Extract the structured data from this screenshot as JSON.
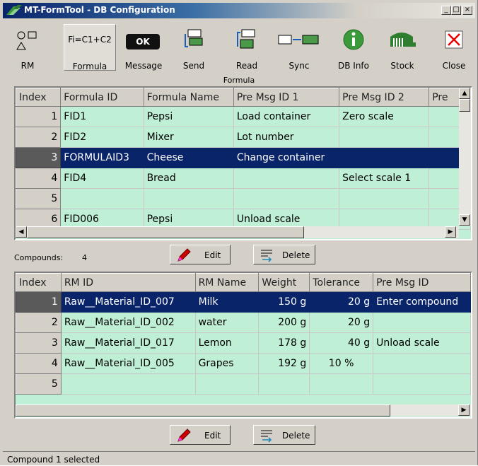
{
  "window": {
    "title": "MT-FormTool - DB Configuration",
    "minimize": "_",
    "maximize": "□",
    "close": "×"
  },
  "toolbar": {
    "rm": "RM",
    "formula": "Formula",
    "message": "Message",
    "send": "Send",
    "read": "Read",
    "sync": "Sync",
    "dbinfo": "DB Info",
    "stock": "Stock",
    "close": "Close",
    "formula_icon_text": "Fi=C1+C2",
    "message_icon_text": "OK"
  },
  "formula_section": {
    "label": "Formula",
    "columns": [
      "Index",
      "Formula ID",
      "Formula Name",
      "Pre Msg ID 1",
      "Pre Msg ID 2",
      "Pre"
    ],
    "rows": [
      {
        "index": "1",
        "formula_id": "FID1",
        "formula_name": "Pepsi",
        "pre_msg_1": "Load container",
        "pre_msg_2": "Zero scale",
        "pre": ""
      },
      {
        "index": "2",
        "formula_id": "FID2",
        "formula_name": "Mixer",
        "pre_msg_1": "Lot number",
        "pre_msg_2": "",
        "pre": ""
      },
      {
        "index": "3",
        "formula_id": "FORMULAID3",
        "formula_name": "Cheese",
        "pre_msg_1": "Change container",
        "pre_msg_2": "",
        "pre": ""
      },
      {
        "index": "4",
        "formula_id": "FID4",
        "formula_name": "Bread",
        "pre_msg_1": "",
        "pre_msg_2": "Select scale 1",
        "pre": ""
      },
      {
        "index": "5",
        "formula_id": "",
        "formula_name": "",
        "pre_msg_1": "",
        "pre_msg_2": "",
        "pre": ""
      },
      {
        "index": "6",
        "formula_id": "FID006",
        "formula_name": "Pepsi",
        "pre_msg_1": "Unload scale",
        "pre_msg_2": "",
        "pre": ""
      }
    ],
    "selected_row": 2
  },
  "compounds": {
    "label": "Compounds:",
    "count": "4"
  },
  "buttons": {
    "edit": "Edit",
    "delete": "Delete"
  },
  "compound_section": {
    "columns": [
      "Index",
      "RM ID",
      "RM Name",
      "Weight",
      "Tolerance",
      "Pre Msg ID"
    ],
    "rows": [
      {
        "index": "1",
        "rm_id": "Raw__Material_ID_007",
        "rm_name": "Milk",
        "weight": "150 g",
        "tolerance": "20 g",
        "pre_msg": "Enter compound"
      },
      {
        "index": "2",
        "rm_id": "Raw__Material_ID_002",
        "rm_name": "water",
        "weight": "200 g",
        "tolerance": "20 g",
        "pre_msg": ""
      },
      {
        "index": "3",
        "rm_id": "Raw__Material_ID_017",
        "rm_name": "Lemon",
        "weight": "178 g",
        "tolerance": "40 g",
        "pre_msg": "Unload scale"
      },
      {
        "index": "4",
        "rm_id": "Raw__Material_ID_005",
        "rm_name": "Grapes",
        "weight": "192 g",
        "tolerance": "10 %",
        "pre_msg": ""
      },
      {
        "index": "5",
        "rm_id": "",
        "rm_name": "",
        "weight": "",
        "tolerance": "",
        "pre_msg": ""
      }
    ],
    "selected_row": 0
  },
  "status": {
    "text": "Compound 1 selected"
  },
  "colors": {
    "grid_bg": "#bfefd4",
    "selection": "#0a246a",
    "face": "#d4d0c8"
  }
}
